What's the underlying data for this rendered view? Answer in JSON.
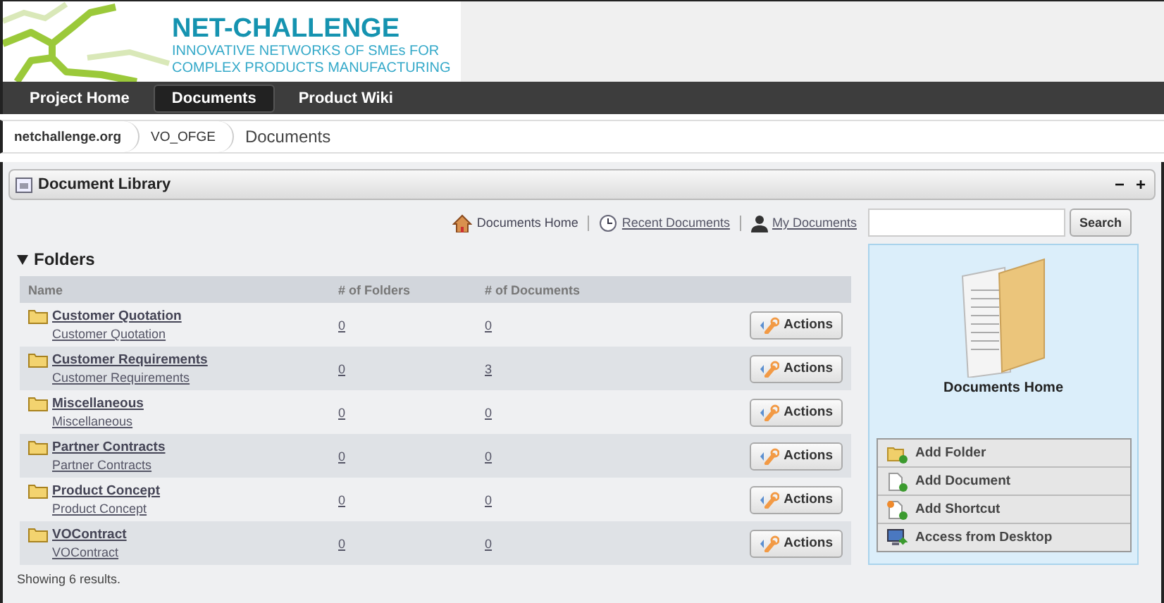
{
  "banner": {
    "title": "NET-CHALLENGE",
    "subtitle": [
      "INNOVATIVE NETWORKS OF SMEs FOR",
      "COMPLEX PRODUCTS MANUFACTURING"
    ]
  },
  "nav": [
    {
      "label": "Project Home",
      "selected": false
    },
    {
      "label": "Documents",
      "selected": true
    },
    {
      "label": "Product Wiki",
      "selected": false
    }
  ],
  "breadcrumb": [
    "netchallenge.org",
    "VO_OFGE",
    "Documents"
  ],
  "portlet": {
    "title": "Document Library",
    "controls": [
      "−",
      "+"
    ]
  },
  "toolbar": {
    "links": [
      {
        "label": "Documents Home",
        "kind": "home",
        "selected": true
      },
      {
        "label": "Recent Documents",
        "kind": "recent",
        "selected": false
      },
      {
        "label": "My Documents",
        "kind": "user",
        "selected": false
      }
    ],
    "search_button": "Search"
  },
  "folders": {
    "heading": "Folders",
    "expanded": true,
    "columns": [
      "Name",
      "# of Folders",
      "# of Documents"
    ],
    "rows": [
      {
        "name": "Customer Quotation",
        "description": "Customer Quotation",
        "folders": "0",
        "documents": "0",
        "action": "Actions"
      },
      {
        "name": "Customer Requirements",
        "description": "Customer Requirements",
        "folders": "0",
        "documents": "3",
        "action": "Actions"
      },
      {
        "name": "Miscellaneous",
        "description": "Miscellaneous",
        "folders": "0",
        "documents": "0",
        "action": "Actions"
      },
      {
        "name": "Partner Contracts",
        "description": "Partner Contracts",
        "folders": "0",
        "documents": "0",
        "action": "Actions"
      },
      {
        "name": "Product Concept",
        "description": "Product Concept",
        "folders": "0",
        "documents": "0",
        "action": "Actions"
      },
      {
        "name": "VOContract",
        "description": "VOContract",
        "folders": "0",
        "documents": "0",
        "action": "Actions"
      }
    ],
    "summary": "Showing 6 results."
  },
  "home_panel": {
    "title": "Documents Home",
    "actions": [
      {
        "label": "Add Folder",
        "kind": "folder"
      },
      {
        "label": "Add Document",
        "kind": "document"
      },
      {
        "label": "Add Shortcut",
        "kind": "shortcut"
      },
      {
        "label": "Access from Desktop",
        "kind": "desktop"
      }
    ]
  }
}
